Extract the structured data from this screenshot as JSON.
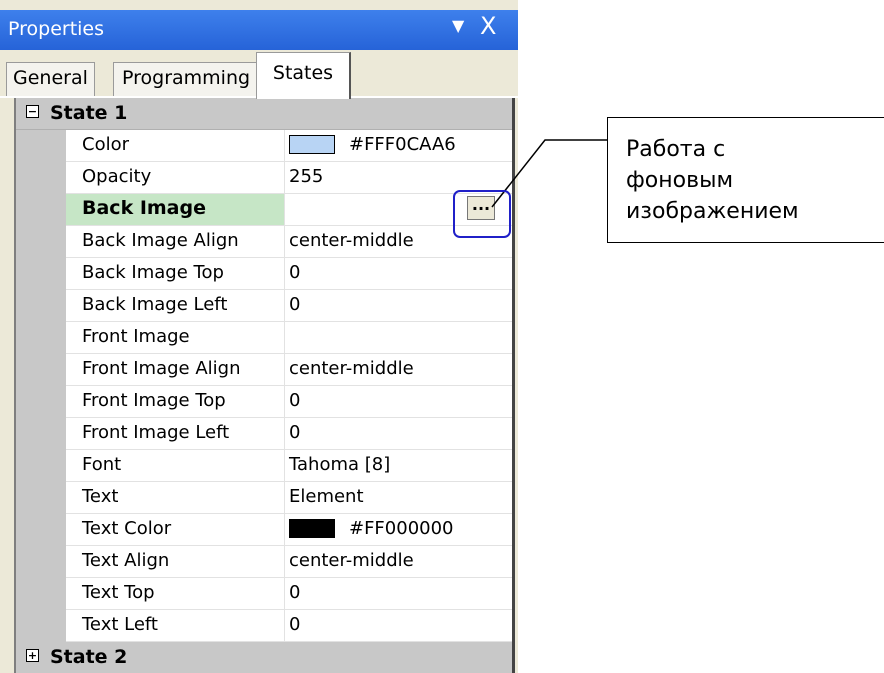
{
  "window": {
    "title": "Properties",
    "pin_glyph": "▼",
    "close_glyph": "X"
  },
  "tabs": [
    {
      "label": "General"
    },
    {
      "label": "Programming"
    },
    {
      "label": "States"
    }
  ],
  "categories": {
    "state1": {
      "label": "State 1",
      "expander": "−"
    },
    "state2": {
      "label": "State 2",
      "expander": "+"
    }
  },
  "properties": [
    {
      "name": "Color",
      "value": "#FFF0CAA6",
      "swatch": "#b8d4f4"
    },
    {
      "name": "Opacity",
      "value": "255"
    },
    {
      "name": "Back Image",
      "value": "",
      "button": "..."
    },
    {
      "name": "Back Image Align",
      "value": "center-middle"
    },
    {
      "name": "Back Image Top",
      "value": "0"
    },
    {
      "name": "Back Image Left",
      "value": "0"
    },
    {
      "name": "Front Image",
      "value": ""
    },
    {
      "name": "Front Image Align",
      "value": "center-middle"
    },
    {
      "name": "Front Image Top",
      "value": "0"
    },
    {
      "name": "Front Image Left",
      "value": "0"
    },
    {
      "name": "Font",
      "value": "Tahoma [8]"
    },
    {
      "name": "Text",
      "value": "Element"
    },
    {
      "name": "Text Color",
      "value": "#FF000000",
      "swatch": "#000000"
    },
    {
      "name": "Text Align",
      "value": "center-middle"
    },
    {
      "name": "Text Top",
      "value": "0"
    },
    {
      "name": "Text Left",
      "value": "0"
    }
  ],
  "callout": {
    "text": "Работа с\nфоновым\nизображением"
  }
}
